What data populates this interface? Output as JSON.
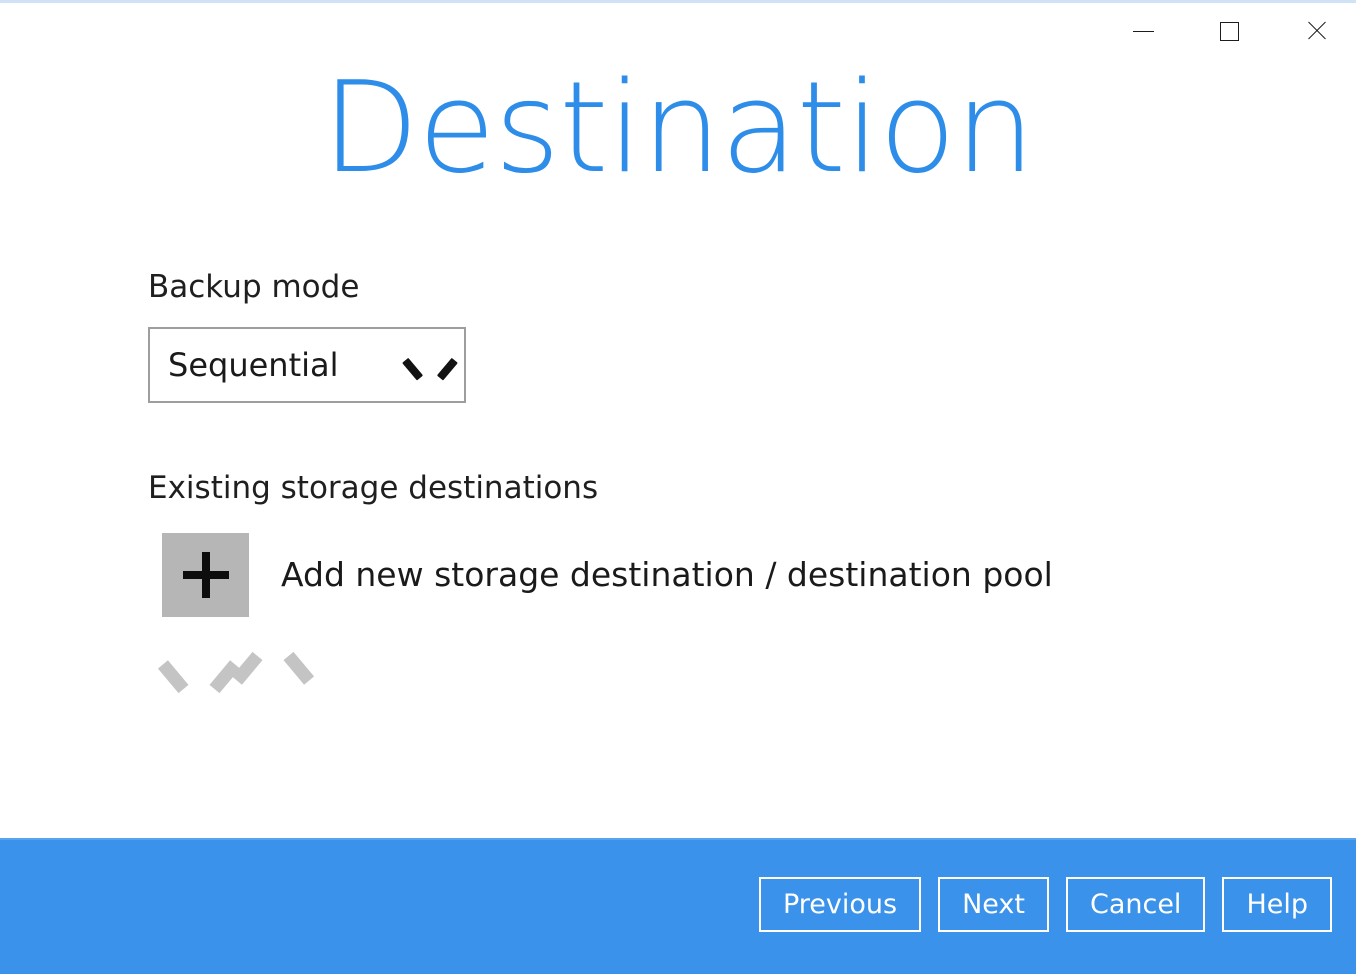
{
  "window": {
    "controls": [
      {
        "name": "minimize",
        "label": "Minimize",
        "glyph": "minimize-icon"
      },
      {
        "name": "maximize",
        "label": "Maximize",
        "glyph": "maximize-icon"
      },
      {
        "name": "close",
        "label": "Close",
        "glyph": "close-icon"
      }
    ],
    "title": "Destination",
    "title_color": "#2e8de8",
    "background": "#ffffff"
  },
  "main": {
    "backup_mode": {
      "label": "Backup mode",
      "selected": "Sequential",
      "options": [
        "Sequential"
      ],
      "chevron_icon": "chevron-down-icon",
      "border_color": "#9e9e9e"
    },
    "destinations": {
      "label": "Existing storage destinations",
      "add_row": {
        "icon": "plus-icon",
        "label": "Add new storage destination / destination pool",
        "button_color": "#b6b6b6"
      },
      "reorder": {
        "up_icon": "chevron-up-icon",
        "up_label": "Move up",
        "down_icon": "chevron-down-icon",
        "down_label": "Move down",
        "arrow_color": "#c4c4c4",
        "disabled": true
      },
      "items": []
    }
  },
  "footer": {
    "background": "#3a92ea",
    "buttons": [
      {
        "name": "previous",
        "label": "Previous"
      },
      {
        "name": "next",
        "label": "Next"
      },
      {
        "name": "cancel",
        "label": "Cancel"
      },
      {
        "name": "help",
        "label": "Help"
      }
    ]
  }
}
